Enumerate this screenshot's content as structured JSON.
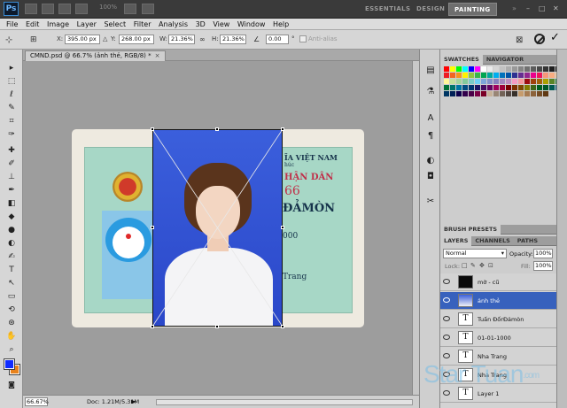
{
  "appbar": {
    "logo": "Ps",
    "zoom_value": "100%",
    "workspaces": [
      "ESSENTIALS",
      "DESIGN",
      "PAINTING"
    ],
    "active_workspace": "PAINTING",
    "window_controls": [
      "–",
      "□",
      "✕"
    ]
  },
  "menu": [
    "File",
    "Edit",
    "Image",
    "Layer",
    "Select",
    "Filter",
    "Analysis",
    "3D",
    "View",
    "Window",
    "Help"
  ],
  "options": {
    "x_label": "X:",
    "x_value": "395.00 px",
    "y_label": "Y:",
    "y_value": "268.00 px",
    "w_label": "W:",
    "w_value": "21.36%",
    "h_label": "H:",
    "h_value": "21.36%",
    "angle_value": "0.00",
    "angle_unit": "°",
    "antialias_label": "Anti-alias"
  },
  "document": {
    "tab_title": "CMND.psd @ 66.7% (ảnh thẻ, RGB/8) *",
    "tab_close": "×",
    "card_text": {
      "country": "ĨA VIỆT NAM",
      "motto": "húc",
      "title": "HẬN DÂN",
      "number": "66",
      "name": "ĐẢMÒN",
      "dob": "000",
      "place": "Trang"
    }
  },
  "status": {
    "zoom": "66.67%",
    "doc_info": "Doc: 1.21M/5.31M",
    "arrow": "►"
  },
  "panels": {
    "top_tabs": [
      "SWATCHES",
      "NAVIGATOR"
    ],
    "brush_presets": "BRUSH PRESETS",
    "layer_tabs": [
      "LAYERS",
      "CHANNELS",
      "PATHS"
    ],
    "blend_mode": "Normal",
    "opacity_label": "Opacity:",
    "opacity_value": "100%",
    "lock_label": "Lock:",
    "fill_label": "Fill:",
    "fill_value": "100%",
    "layers": [
      {
        "name": "mờ - cũ",
        "kind": "image",
        "selected": false
      },
      {
        "name": "ảnh thẻ",
        "kind": "photo",
        "selected": true
      },
      {
        "name": "Tuấn ĐốrĐảmòn",
        "kind": "text",
        "selected": false
      },
      {
        "name": "01-01-1000",
        "kind": "text",
        "selected": false
      },
      {
        "name": "Nha Trang",
        "kind": "text",
        "selected": false
      },
      {
        "name": "Nha Trang",
        "kind": "text",
        "selected": false
      },
      {
        "name": "Layer 1",
        "kind": "text",
        "selected": false
      }
    ]
  },
  "watermark": {
    "text": "Star Tuan",
    "suffix": ".com"
  },
  "swatch_colors": [
    "#ff0000",
    "#ffff00",
    "#00ff00",
    "#00ffff",
    "#0000ff",
    "#ff00ff",
    "#ffffff",
    "#ebebeb",
    "#d6d6d6",
    "#c2c2c2",
    "#adadad",
    "#999999",
    "#858585",
    "#707070",
    "#5c5c5c",
    "#474747",
    "#333333",
    "#1f1f1f",
    "#000000",
    "#ed1c24",
    "#f26522",
    "#f7941d",
    "#fff200",
    "#8dc63f",
    "#39b54a",
    "#00a651",
    "#00a99d",
    "#00aeef",
    "#0072bc",
    "#0054a6",
    "#2e3192",
    "#662d91",
    "#92278f",
    "#ec008c",
    "#ed145b",
    "#f7977a",
    "#f9ad81",
    "#fdc68a",
    "#fff79a",
    "#c4df9b",
    "#a3d39c",
    "#82ca9c",
    "#7accc8",
    "#6dcff6",
    "#7da7d9",
    "#8393ca",
    "#8781bd",
    "#a187be",
    "#bd8cbf",
    "#f49ac2",
    "#f6989d",
    "#9e0b0f",
    "#a0410d",
    "#a3620a",
    "#aba000",
    "#598527",
    "#197b30",
    "#007236",
    "#00746b",
    "#0076a3",
    "#004b80",
    "#003471",
    "#1b1464",
    "#440e62",
    "#630460",
    "#9e005d",
    "#9e0039",
    "#790000",
    "#7b2e00",
    "#7d4900",
    "#827b00",
    "#406618",
    "#005e20",
    "#005826",
    "#005952",
    "#005b7f",
    "#003663",
    "#002157",
    "#0d004c",
    "#32004b",
    "#4b0049",
    "#7b0046",
    "#7a0026",
    "#c7b299",
    "#998675",
    "#736357",
    "#534741",
    "#37302a",
    "#c69c6d",
    "#a67c52",
    "#8c6239",
    "#754c24",
    "#603913"
  ]
}
